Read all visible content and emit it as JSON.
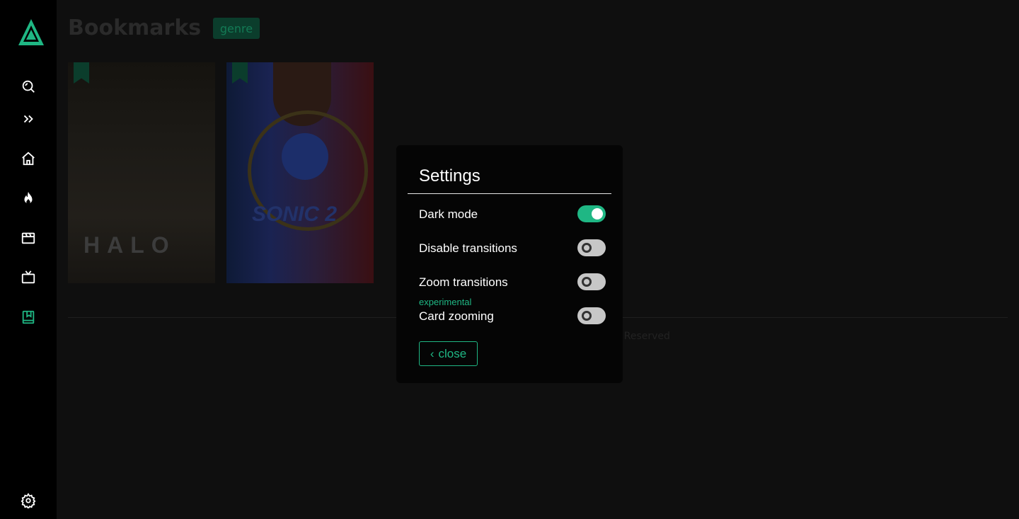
{
  "app": {
    "accent_color": "#1fb784"
  },
  "sidebar": {
    "items": [
      {
        "icon": "search-icon"
      },
      {
        "icon": "chevrons-right-icon"
      },
      {
        "icon": "home-icon"
      },
      {
        "icon": "flame-icon"
      },
      {
        "icon": "clapperboard-icon"
      },
      {
        "icon": "tv-icon"
      },
      {
        "icon": "bookmark-book-icon",
        "active": true
      },
      {
        "icon": "gear-icon"
      }
    ]
  },
  "page": {
    "title": "Bookmarks",
    "badge": "genre",
    "cards": [
      {
        "title_art": "HALO"
      },
      {
        "title_art": "SONIC 2"
      }
    ],
    "footer_text": "s Reserved"
  },
  "settings": {
    "title": "Settings",
    "options": [
      {
        "label": "Dark mode",
        "enabled": true
      },
      {
        "label": "Disable transitions",
        "enabled": false
      },
      {
        "label": "Zoom transitions",
        "enabled": false
      },
      {
        "label": "Card zooming",
        "note": "experimental",
        "enabled": false
      }
    ],
    "close_label": "close",
    "close_chevron": "‹"
  }
}
